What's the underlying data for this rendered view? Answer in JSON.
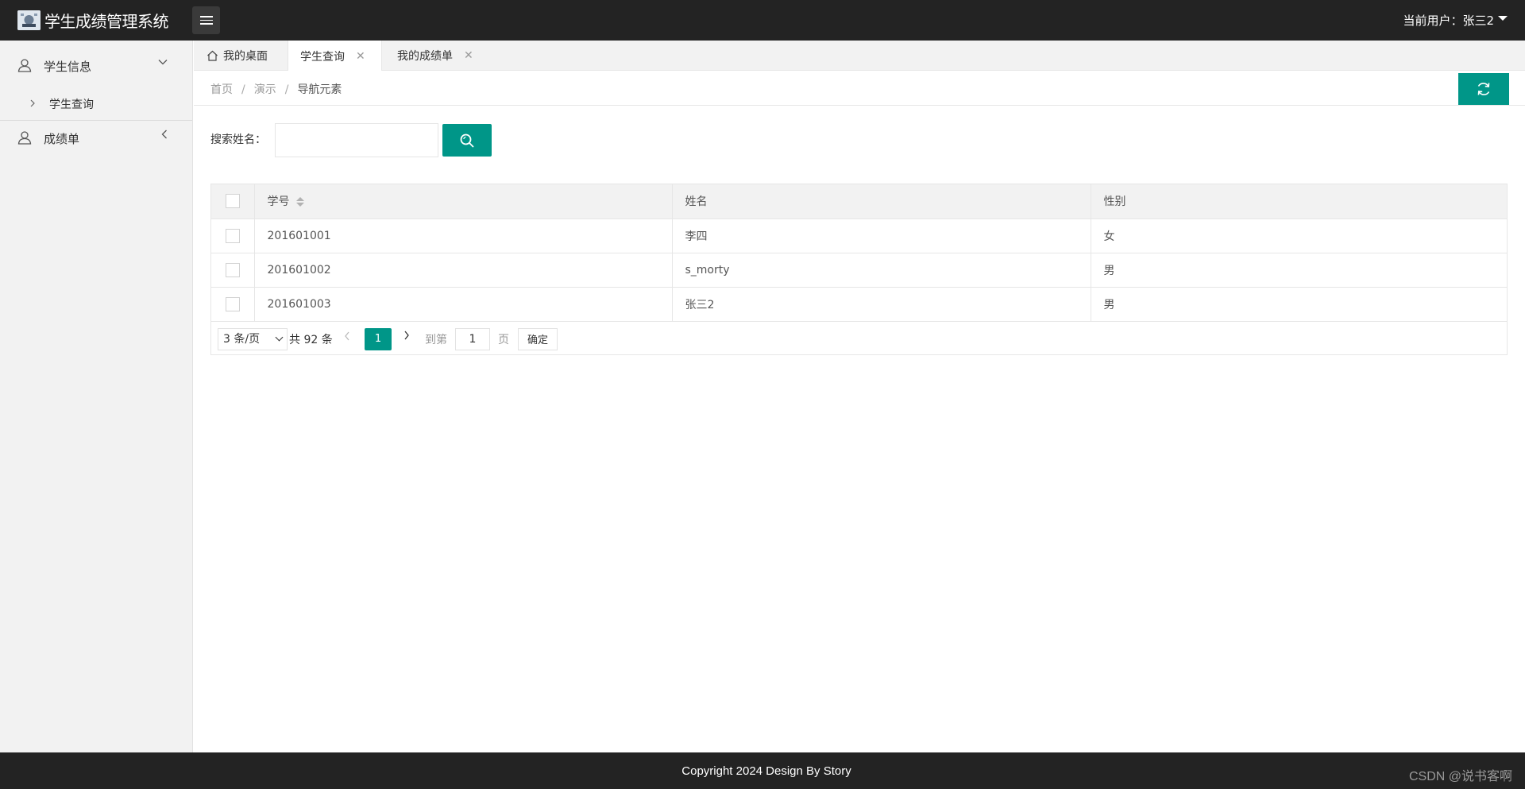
{
  "header": {
    "title": "学生成绩管理系统",
    "user_label": "当前用户：张三2"
  },
  "sidebar": {
    "groups": [
      {
        "label": "学生信息",
        "items": [
          {
            "label": "学生查询"
          }
        ]
      },
      {
        "label": "成绩单",
        "items": []
      }
    ]
  },
  "tabs": [
    {
      "label": "我的桌面"
    },
    {
      "label": "学生查询",
      "close": "✕"
    },
    {
      "label": "我的成绩单",
      "close": "✕"
    }
  ],
  "breadcrumb": {
    "items": [
      "首页",
      "演示",
      "导航元素"
    ],
    "separator": "/"
  },
  "search": {
    "label": "搜索姓名：",
    "value": "",
    "placeholder": ""
  },
  "table": {
    "columns": [
      "学号",
      "姓名",
      "性别"
    ],
    "rows": [
      {
        "id": "201601001",
        "name": "李四",
        "gender": "女"
      },
      {
        "id": "201601002",
        "name": "s_morty",
        "gender": "男"
      },
      {
        "id": "201601003",
        "name": "张三2",
        "gender": "男"
      }
    ]
  },
  "pagination": {
    "page_size": "3 条/页",
    "total": "共 92 条",
    "current_page": "1",
    "goto_label": "到第",
    "goto_value": "1",
    "unit": "页",
    "confirm": "确定"
  },
  "footer": {
    "copyright": "Copyright 2024 Design By Story",
    "watermark": "CSDN @说书客啊"
  },
  "colors": {
    "accent": "#009688",
    "header_bg": "#232323",
    "sidebar_bg": "#f2f2f2"
  }
}
